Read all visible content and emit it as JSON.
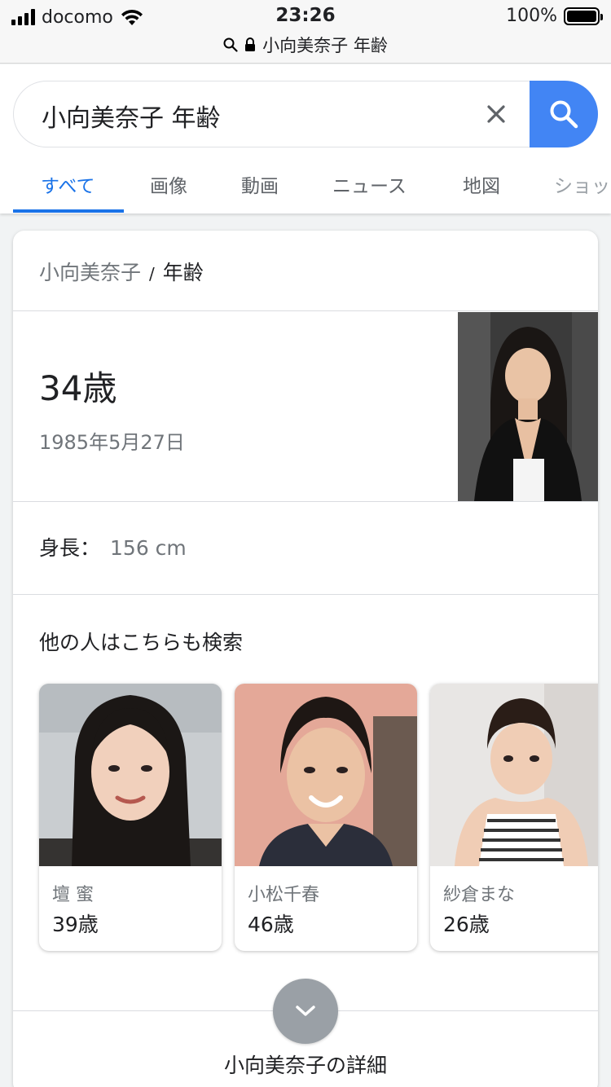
{
  "status_bar": {
    "carrier": "docomo",
    "time": "23:26",
    "battery": "100%",
    "url_text": "小向美奈子 年齢"
  },
  "search": {
    "query": "小向美奈子 年齢"
  },
  "tabs": [
    {
      "label": "すべて",
      "active": true
    },
    {
      "label": "画像"
    },
    {
      "label": "動画"
    },
    {
      "label": "ニュース"
    },
    {
      "label": "地図"
    },
    {
      "label": "ショッ"
    }
  ],
  "knowledge": {
    "breadcrumb_entity": "小向美奈子",
    "breadcrumb_separator": "/",
    "breadcrumb_attribute": "年齢",
    "age": "34歳",
    "birth_date": "1985年5月27日",
    "height_label": "身長：",
    "height_value": "156 cm",
    "also_searched_title": "他の人はこちらも検索",
    "people": [
      {
        "name": "壇 蜜",
        "age": "39歳"
      },
      {
        "name": "小松千春",
        "age": "46歳"
      },
      {
        "name": "紗倉まな",
        "age": "26歳"
      }
    ],
    "details_link": "小向美奈子の詳細"
  },
  "colors": {
    "accent": "#1a73e8",
    "search_button": "#4285f4",
    "more_button": "#9aa0a6"
  }
}
